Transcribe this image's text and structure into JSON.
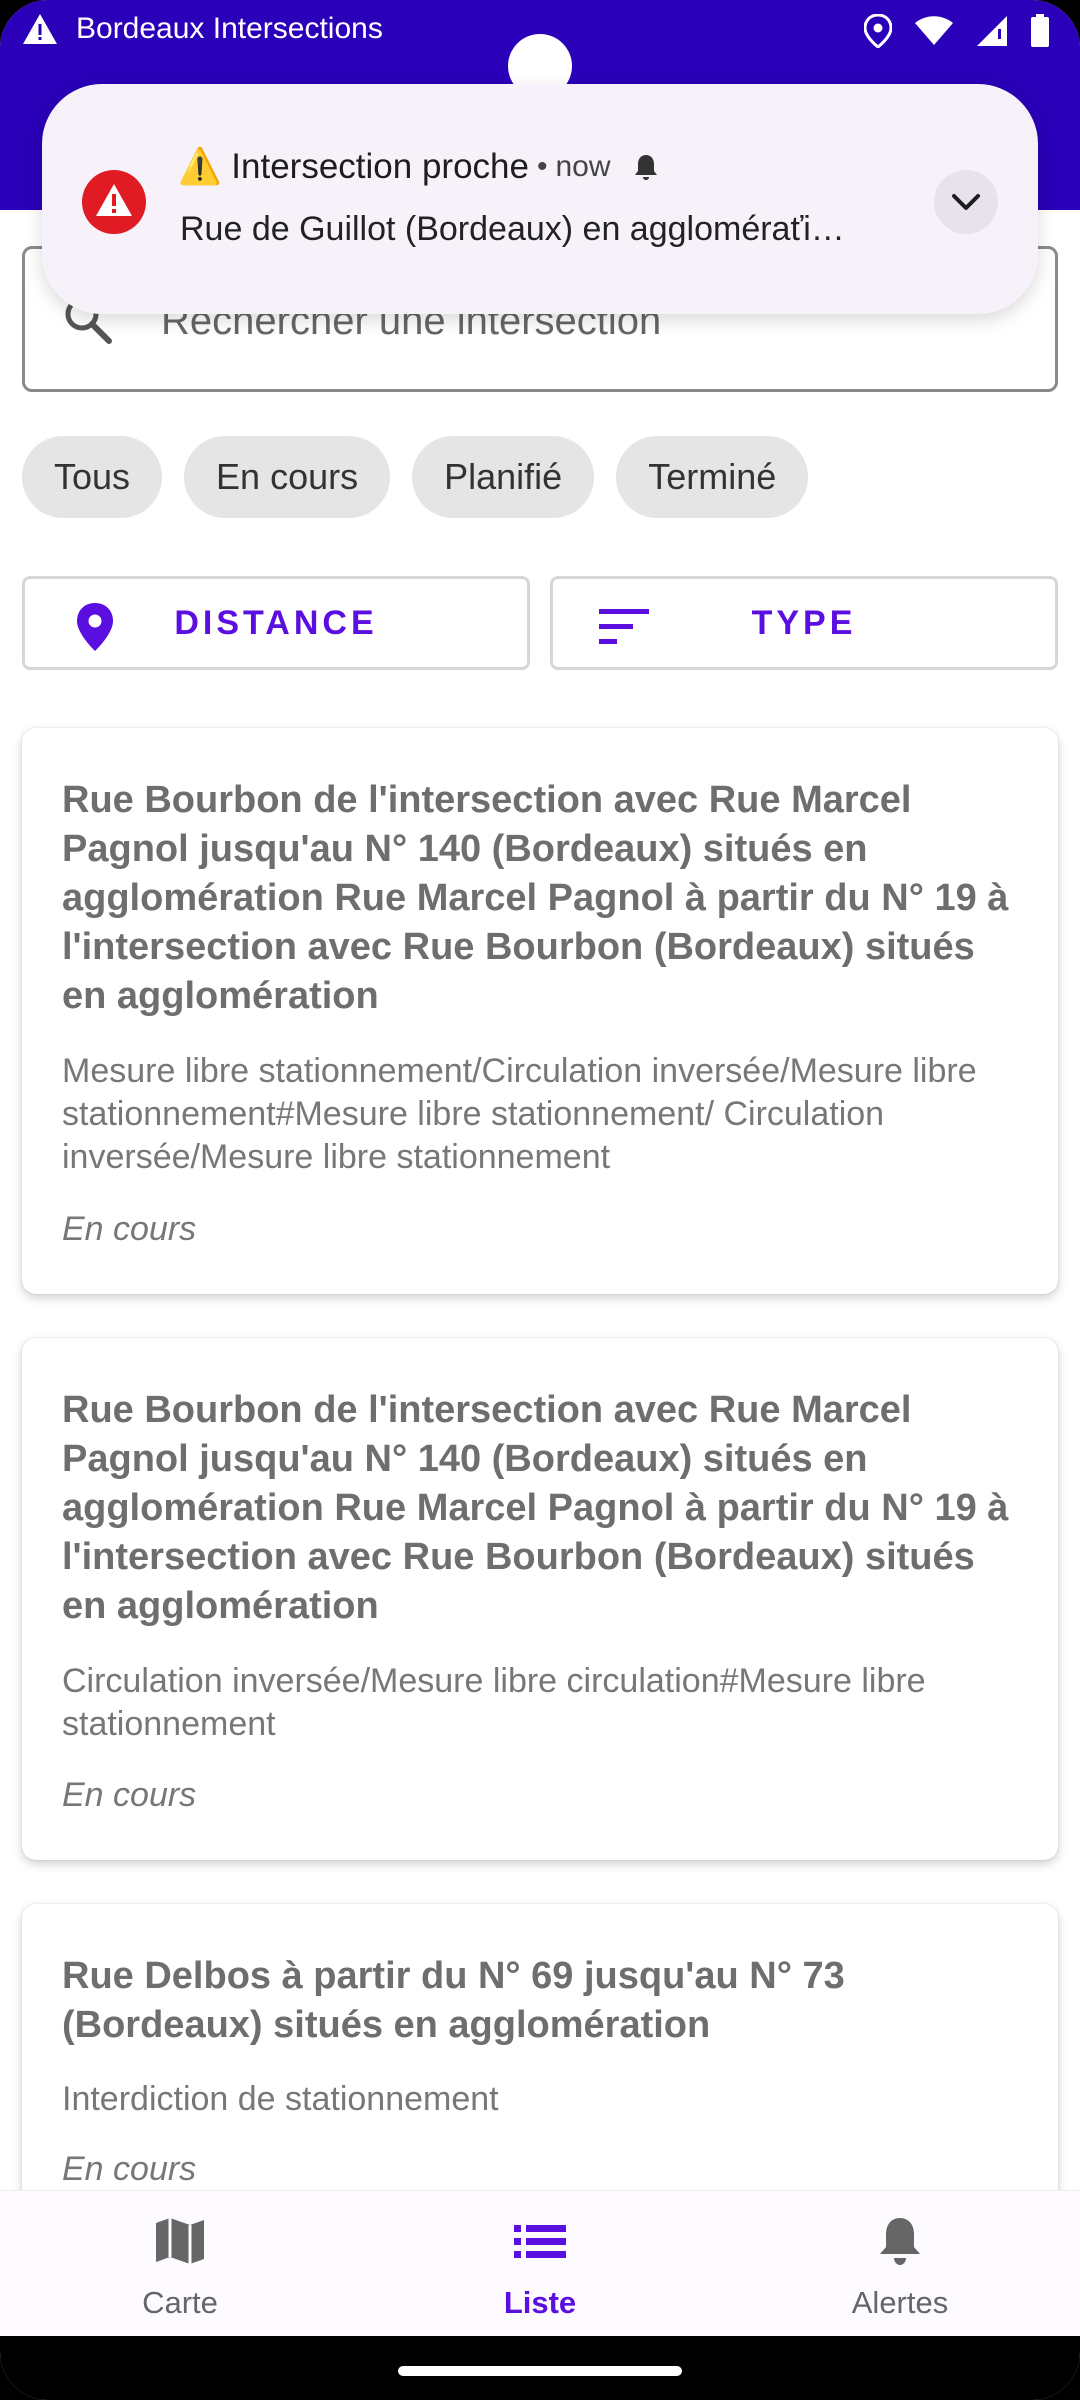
{
  "status_bar": {
    "app_title": "Bordeaux Intersections",
    "icons": [
      "warning-icon",
      "location-icon",
      "wifi-icon",
      "signal-icon",
      "battery-icon"
    ]
  },
  "notification": {
    "title": "⚠️ Intersection proche",
    "separator": "•",
    "time": "now",
    "text": "Rue de Guillot (Bordeaux) en aggloméraťi…"
  },
  "search": {
    "placeholder": "Rechercher une intersection"
  },
  "chips": [
    "Tous",
    "En cours",
    "Planifié",
    "Terminé"
  ],
  "sort": {
    "distance_label": "DISTANCE",
    "type_label": "TYPE"
  },
  "cards": [
    {
      "title": "Rue Bourbon de l'intersection avec Rue Marcel Pagnol jusqu'au N° 140 (Bordeaux) situés en agglomération Rue Marcel Pagnol à partir du N° 19 à l'intersection avec Rue Bourbon (Bordeaux) situés en agglomération",
      "description": "Mesure libre stationnement/Circulation inversée/Mesure libre stationnement#Mesure libre stationnement/ Circulation inversée/Mesure libre stationnement",
      "status": "En cours"
    },
    {
      "title": "Rue Bourbon de l'intersection avec Rue Marcel Pagnol jusqu'au N° 140 (Bordeaux) situés en agglomération Rue Marcel Pagnol à partir du N° 19 à l'intersection avec Rue Bourbon (Bordeaux) situés en agglomération",
      "description": "Circulation inversée/Mesure libre circulation#Mesure libre stationnement",
      "status": "En cours"
    },
    {
      "title": "Rue Delbos à partir du N° 69 jusqu'au N° 73 (Bordeaux) situés en agglomération",
      "description": "Interdiction de stationnement",
      "status": "En cours"
    }
  ],
  "bottom_nav": [
    {
      "label": "Carte",
      "icon": "map-icon"
    },
    {
      "label": "Liste",
      "icon": "list-icon",
      "active": true
    },
    {
      "label": "Alertes",
      "icon": "bell-icon"
    }
  ],
  "colors": {
    "primary": "#2a00b8",
    "accent": "#5b0ee0",
    "alert_red": "#e01b24"
  }
}
